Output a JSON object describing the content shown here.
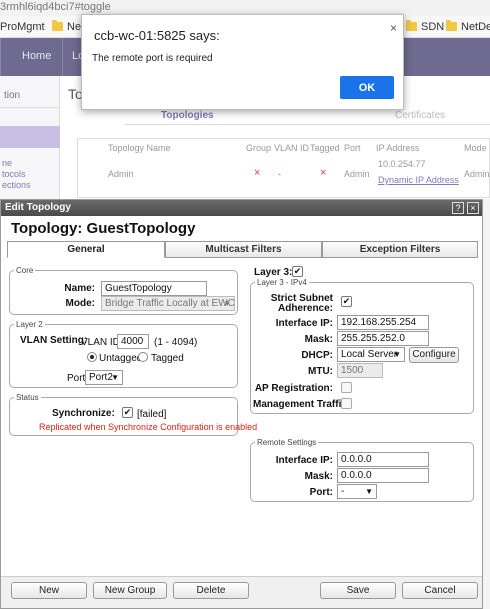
{
  "browser": {
    "url_fragment": "3rmhl6iqd4bci7#toggle",
    "bookmarks": [
      "ProMgmt",
      "Net",
      "SDN",
      "NetDe"
    ]
  },
  "app_bg": {
    "nav": [
      "Home",
      "Lo"
    ],
    "left_panel": {
      "heading": "tion",
      "items": [
        "ne",
        "tocols",
        "ections"
      ]
    },
    "main": {
      "title": "To",
      "tabs": [
        "Topologies",
        "Certificates"
      ],
      "table": {
        "headers": [
          "Topology Name",
          "Group",
          "VLAN ID",
          "Tagged",
          "Port",
          "IP Address",
          "Mode"
        ],
        "row": {
          "name": "Admin",
          "group": "×",
          "vlan": "-",
          "tagged": "×",
          "port": "Admin",
          "ip": "10.0.254.77",
          "ip_sub": "Dynamic IP Address",
          "mode": "Admin"
        }
      }
    }
  },
  "alert": {
    "title": "ccb-wc-01:5825 says:",
    "message": "The remote port is required",
    "ok_label": "OK",
    "close_glyph": "×"
  },
  "edit_window": {
    "titlebar": "Edit Topology",
    "help_glyph": "?",
    "close_glyph": "×",
    "heading": "Topology: GuestTopology",
    "tabs": [
      "General",
      "Multicast Filters",
      "Exception Filters"
    ],
    "core": {
      "legend": "Core",
      "name_label": "Name:",
      "name_value": "GuestTopology",
      "mode_label": "Mode:",
      "mode_value": "Bridge Traffic Locally at EWC"
    },
    "layer2": {
      "legend": "Layer 2",
      "vlan_setting_label": "VLAN Setting:",
      "vlan_id_label": "VLAN ID:",
      "vlan_id_value": "4000",
      "vlan_range": "(1 - 4094)",
      "untagged_label": "Untagged",
      "tagged_label": "Tagged",
      "selected": "untagged",
      "port_label": "Port:",
      "port_value": "Port2"
    },
    "status": {
      "legend": "Status",
      "sync_label": "Synchronize:",
      "sync_checked": true,
      "sync_status": "[failed]",
      "warning": "Replicated when Synchronize Configuration is enabled"
    },
    "layer3": {
      "label": "Layer 3:",
      "checked": true,
      "legend": "Layer 3 - IPv4",
      "strict_label_1": "Strict Subnet",
      "strict_label_2": "Adherence:",
      "strict_checked": true,
      "interface_ip_label": "Interface IP:",
      "interface_ip_value": "192.168.255.254",
      "mask_label": "Mask:",
      "mask_value": "255.255.252.0",
      "dhcp_label": "DHCP:",
      "dhcp_value": "Local Server",
      "configure_label": "Configure",
      "mtu_label": "MTU:",
      "mtu_value": "1500",
      "ap_reg_label": "AP Registration:",
      "ap_reg_checked": false,
      "mgmt_label": "Management Traffic:",
      "mgmt_checked": false
    },
    "remote": {
      "legend": "Remote Settings",
      "interface_ip_label": "Interface IP:",
      "interface_ip_value": "0.0.0.0",
      "mask_label": "Mask:",
      "mask_value": "0.0.0.0",
      "port_label": "Port:",
      "port_value": "-"
    },
    "footer": {
      "new": "New",
      "new_group": "New Group",
      "delete": "Delete",
      "save": "Save",
      "cancel": "Cancel"
    }
  },
  "colors": {
    "nav_bg": "#6f6a8f",
    "ok_button": "#1a73e8",
    "warning_text": "#dd2211",
    "tab_link": "#8777b8"
  }
}
